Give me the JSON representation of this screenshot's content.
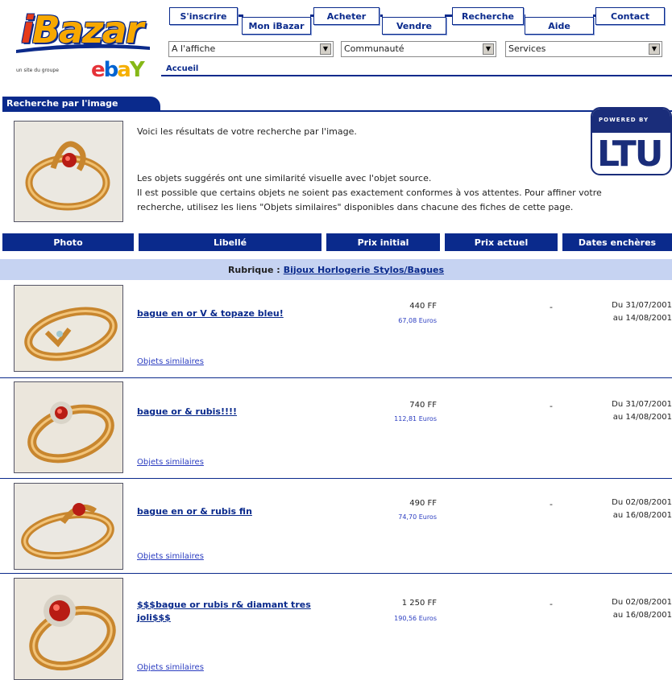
{
  "logo": {
    "text_i": "i",
    "text_rest": "Bazar",
    "tagline": "un site du groupe"
  },
  "ebay": {
    "e": "e",
    "b": "b",
    "a": "a",
    "y": "Y"
  },
  "nav": {
    "sinscrire": "S'inscrire",
    "mon_ibazar": "Mon iBazar",
    "acheter": "Acheter",
    "vendre": "Vendre",
    "recherche": "Recherche",
    "aide": "Aide",
    "contact": "Contact"
  },
  "selects": {
    "affiche": "A l'affiche",
    "communaute": "Communauté",
    "services": "Services"
  },
  "breadcrumb": "Accueil",
  "search_panel": {
    "tab_title": "Recherche par l'image",
    "intro": "Voici les résultats de votre recherche par l'image.",
    "notes": "Les objets suggérés ont une similarité visuelle avec l'objet source.\nIl est possible que certains objets ne soient pas exactement conformes à vos attentes. Pour affiner votre\nrecherche, utilisez les liens \"Objets similaires\" disponibles dans chacune des fiches de cette page.",
    "ltu_band": "POWERED BY",
    "ltu_word": "LTU"
  },
  "columns": {
    "photo": "Photo",
    "libelle": "Libellé",
    "prix_initial": "Prix initial",
    "prix_actuel": "Prix actuel",
    "dates": "Dates enchères"
  },
  "rubrique": {
    "label": "Rubrique :",
    "link": "Bijoux Horlogerie Stylos/Bagues"
  },
  "results": [
    {
      "title": "bague en or V & topaze bleu!",
      "price": "440 FF",
      "euro": "67,08 Euros",
      "current": "-",
      "dates": "Du 31/07/2001\nau 14/08/2001",
      "similar": "Objets similaires"
    },
    {
      "title": "bague or & rubis!!!!",
      "price": "740 FF",
      "euro": "112,81 Euros",
      "current": "-",
      "dates": "Du 31/07/2001\nau 14/08/2001",
      "similar": "Objets similaires"
    },
    {
      "title": "bague en or & rubis fin",
      "price": "490 FF",
      "euro": "74,70 Euros",
      "current": "-",
      "dates": "Du 02/08/2001\nau 16/08/2001",
      "similar": "Objets similaires"
    },
    {
      "title": "$$$bague or rubis r& diamant tres joli$$$",
      "price": "1 250 FF",
      "euro": "190,56 Euros",
      "current": "-",
      "dates": "Du 02/08/2001\nau 16/08/2001",
      "similar": "Objets similaires"
    }
  ],
  "colors": {
    "navy": "#0a2a8c",
    "rubrique_bg": "#c6d3f2",
    "gold": "#d89a3a",
    "ruby": "#c0201a"
  }
}
